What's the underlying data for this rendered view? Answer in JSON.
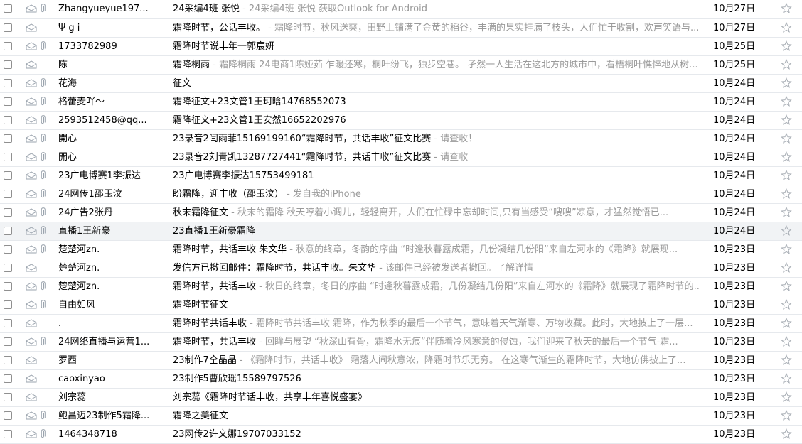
{
  "icons": {
    "read": "envelope-open-icon",
    "attachment": "paperclip-icon",
    "star": "star-outline-icon",
    "checkbox": "checkbox-icon"
  },
  "colors": {
    "preview": "#9a9a9a",
    "highlight_row": "#f1f3f5",
    "divider": "#e6e9ed"
  },
  "emails": [
    {
      "sender": "Zhangyueyue197...",
      "subject": "24采编4班  张悦",
      "preview": " - 24采编4班  张悦  获取Outlook for Android",
      "date": "10月27日",
      "attachment": true,
      "highlight": false
    },
    {
      "sender": "Ψ g i",
      "subject": "霜降时节，公话丰收。",
      "preview": " - 霜降时节，秋风送爽，田野上铺满了金黄的稻谷，丰满的果实挂满了枝头，人们忙于收割，欢声笑语与...",
      "date": "10月27日",
      "attachment": false,
      "highlight": false
    },
    {
      "sender": "1733782989",
      "subject": "霜降时节说丰年一郭宸妍",
      "preview": "",
      "date": "10月25日",
      "attachment": true,
      "highlight": false
    },
    {
      "sender": "陈",
      "subject": "霜降桐雨",
      "preview": " - 霜降桐雨 24电商1陈娅茹 乍暖还寒，桐叶纷飞，独步空巷。 孑然一人生活在这北方的城市中，看梧桐叶憔悴地从树...",
      "date": "10月25日",
      "attachment": false,
      "highlight": false
    },
    {
      "sender": "花海",
      "subject": "征文",
      "preview": "",
      "date": "10月24日",
      "attachment": true,
      "highlight": false
    },
    {
      "sender": "格蕾麦吖～",
      "subject": "霜降征文+23文管1王珂晗14768552073",
      "preview": "",
      "date": "10月24日",
      "attachment": true,
      "highlight": false
    },
    {
      "sender": "2593512458@qq...",
      "subject": "霜降征文+23文管1王安然16652202976",
      "preview": "",
      "date": "10月24日",
      "attachment": true,
      "highlight": false
    },
    {
      "sender": "開心",
      "subject": "23录音2闫雨菲15169199160“霜降时节，共话丰收”征文比赛",
      "preview": " - 请查收！",
      "date": "10月24日",
      "attachment": true,
      "highlight": false
    },
    {
      "sender": "開心",
      "subject": "23录音2刘青凯13287727441“霜降时节，共话丰收”征文比赛",
      "preview": " - 请查收",
      "date": "10月24日",
      "attachment": true,
      "highlight": false
    },
    {
      "sender": "23广电博赛1李振达",
      "subject": "23广电博赛李振达15753499181",
      "preview": "",
      "date": "10月24日",
      "attachment": true,
      "highlight": false
    },
    {
      "sender": "24网传1邵玉汶",
      "subject": "盼霜降，迎丰收（邵玉汶）",
      "preview": " - 发自我的iPhone",
      "date": "10月24日",
      "attachment": true,
      "highlight": false
    },
    {
      "sender": "24广告2张丹",
      "subject": "秋末霜降征文",
      "preview": " - 秋末的霜降          秋天哼着小调儿，轻轻离开，人们在忙碌中忘却时间,只有当感受“嗖嗖”凉意，才猛然觉悟已...",
      "date": "10月24日",
      "attachment": true,
      "highlight": false
    },
    {
      "sender": "直播1王新豪",
      "subject": "23直播1王新豪霜降",
      "preview": "",
      "date": "10月24日",
      "attachment": true,
      "highlight": true
    },
    {
      "sender": "楚楚河zn.",
      "subject": "霜降时节，共话丰收 朱文华",
      "preview": " - 秋意的终章，冬韵的序曲        “时逢秋暮露成霜，几份凝结几份阳”来自左河水的《霜降》就展现...",
      "date": "10月23日",
      "attachment": true,
      "highlight": false
    },
    {
      "sender": "楚楚河zn.",
      "subject": "发信方已撤回邮件：霜降时节，共话丰收。朱文华",
      "preview": " - 该邮件已经被发送者撤回。了解详情",
      "date": "10月23日",
      "attachment": false,
      "highlight": false
    },
    {
      "sender": "楚楚河zn.",
      "subject": "霜降时节，共话丰收",
      "preview": " - 秋日的终章，冬日的序曲 “时逢秋暮露成霜，几份凝结几份阳”来自左河水的《霜降》就展现了霜降时节的...",
      "date": "10月23日",
      "attachment": true,
      "highlight": false
    },
    {
      "sender": "自由如风",
      "subject": "霜降时节征文",
      "preview": "",
      "date": "10月23日",
      "attachment": true,
      "highlight": false
    },
    {
      "sender": ".",
      "subject": "霜降时节共话丰收",
      "preview": " - 霜降时节共话丰收 霜降，作为秋季的最后一个节气，意味着天气渐寒、万物收藏。此时，大地披上了一层...",
      "date": "10月23日",
      "attachment": false,
      "highlight": false
    },
    {
      "sender": "24网络直播与运营1...",
      "subject": "霜降时节，共话丰收",
      "preview": " - 回眸与展望      “秋深山有骨，霜降水无痕”伴随着冷风寒意的侵蚀，我们迎来了秋天的最后一个节气-霜...",
      "date": "10月23日",
      "attachment": true,
      "highlight": false
    },
    {
      "sender": "罗西",
      "subject": "23制作7仝晶晶",
      "preview": " - 《霜降时节，共话丰收》   霜落人间秋意浓，降霜时节乐无穷。    在这寒气渐生的霜降时节，大地仿佛披上了...",
      "date": "10月23日",
      "attachment": false,
      "highlight": false
    },
    {
      "sender": "caoxinyao",
      "subject": "23制作5曹欣瑶15589797526",
      "preview": "",
      "date": "10月23日",
      "attachment": false,
      "highlight": false
    },
    {
      "sender": "刘宗蕊",
      "subject": "刘宗蕊《霜降时节话丰收，共享丰年喜悦盛宴》",
      "preview": "",
      "date": "10月23日",
      "attachment": false,
      "highlight": false
    },
    {
      "sender": "鲍昌迈23制作5霜降...",
      "subject": "霜降之美征文",
      "preview": "",
      "date": "10月23日",
      "attachment": true,
      "highlight": false
    },
    {
      "sender": "1464348718",
      "subject": "23网传2许文娜19707033152",
      "preview": "",
      "date": "10月23日",
      "attachment": true,
      "highlight": false
    }
  ]
}
